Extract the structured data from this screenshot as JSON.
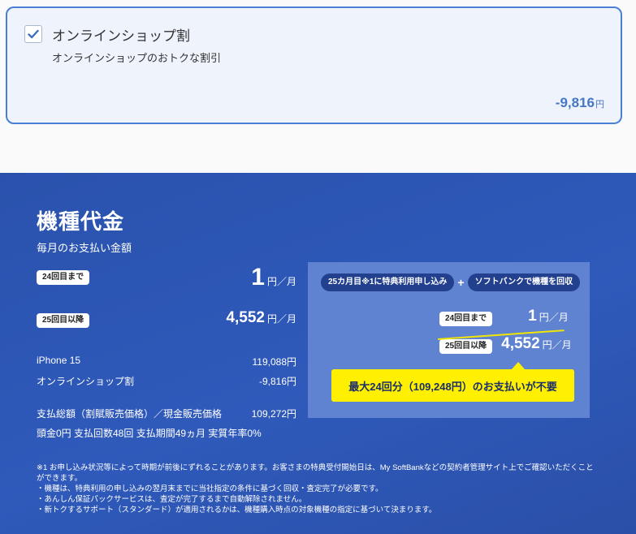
{
  "discount": {
    "checked": true,
    "title": "オンラインショップ割",
    "subtitle": "オンラインショップのおトクな割引",
    "amount": "-9,816",
    "unit": "円"
  },
  "device": {
    "title": "機種代金",
    "subtitle": "毎月のお支払い金額",
    "rows": [
      {
        "badge": "24回目まで",
        "amount": "1",
        "unit": "円／月"
      },
      {
        "badge": "25回目以降",
        "amount": "4,552",
        "unit": "円／月"
      }
    ],
    "lines": [
      {
        "label": "iPhone 15",
        "value": "119,088円"
      },
      {
        "label": "オンラインショップ割",
        "value": "-9,816円"
      },
      {
        "label": "支払総額（割賦販売価格）／現金販売価格",
        "value": "109,272円"
      }
    ],
    "terms": "頭金0円 支払回数48回 支払期間49ヵ月 実質年率0%"
  },
  "promo": {
    "tag1": "25カ月目※1に特典利用申し込み",
    "plus": "+",
    "tag2": "ソフトバンクで機種を回収",
    "rows": [
      {
        "badge": "24回目まで",
        "amount": "1",
        "unit": "円／月"
      },
      {
        "badge": "25回目以降",
        "amount": "4,552",
        "unit": "円／月"
      }
    ],
    "banner": "最大24回分（109,248円）のお支払いが不要"
  },
  "notes": [
    "※1 お申し込み状況等によって時期が前後にずれることがあります。お客さまの特典受付開始日は、My SoftBankなどの契約者管理サイト上でご確認いただくことができます。",
    "・機種は、特典利用の申し込みの翌月末までに当社指定の条件に基づく回収・査定完了が必要です。",
    "・あんしん保証パックサービスは、査定が完了するまで自動解除されません。",
    "・新トクするサポート（スタンダード）が適用されるかは、機種購入時点の対象機種の指定に基づいて決まります。"
  ],
  "colors": {
    "accent": "#4577c5",
    "section_bg": "#2f5abb",
    "promo_box": "#5f83d0",
    "banner": "#ffef00"
  }
}
